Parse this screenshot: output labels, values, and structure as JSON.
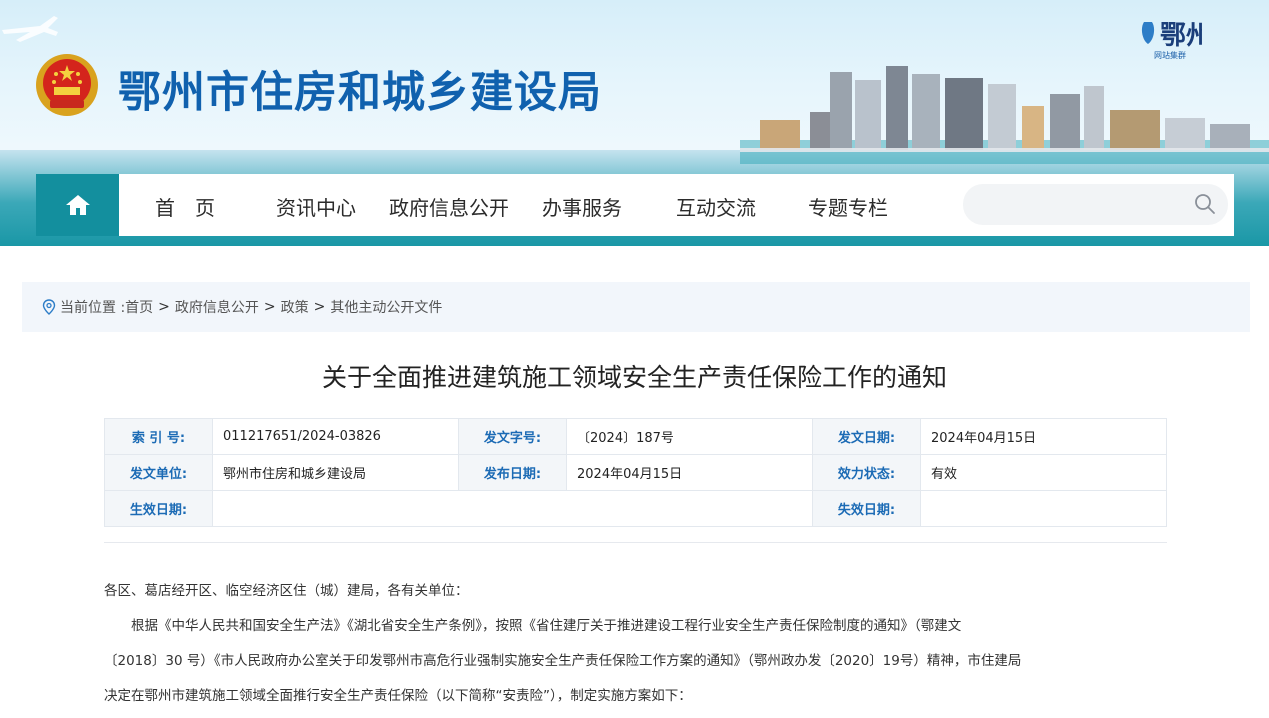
{
  "header": {
    "site_title": "鄂州市住房和城乡建设局",
    "city_logo_glyph": "鄂州",
    "city_logo_subtext": "网站集群"
  },
  "nav": {
    "home_icon": "home-icon",
    "items": [
      "首　页",
      "资讯中心",
      "政府信息公开",
      "办事服务",
      "互动交流",
      "专题专栏"
    ],
    "search_placeholder": ""
  },
  "breadcrumb": {
    "prefix": "当前位置 :",
    "items": [
      "首页",
      "政府信息公开",
      "政策",
      "其他主动公开文件"
    ],
    "separator": ">"
  },
  "article": {
    "title": "关于全面推进建筑施工领域安全生产责任保险工作的通知"
  },
  "meta": {
    "index_label": "索 引 号:",
    "index_value": "011217651/2024-03826",
    "doc_no_label": "发文字号:",
    "doc_no_value": "〔2024〕187号",
    "issue_date_label": "发文日期:",
    "issue_date_value": "2024年04月15日",
    "issuer_label": "发文单位:",
    "issuer_value": "鄂州市住房和城乡建设局",
    "publish_date_label": "发布日期:",
    "publish_date_value": "2024年04月15日",
    "status_label": "效力状态:",
    "status_value": "有效",
    "effective_label": "生效日期:",
    "effective_value": "",
    "expire_label": "失效日期:",
    "expire_value": ""
  },
  "body": {
    "salutation": "各区、葛店经开区、临空经济区住（城）建局，各有关单位：",
    "para1_line1": "根据《中华人民共和国安全生产法》《湖北省安全生产条例》，按照《省住建厅关于推进建设工程行业安全生产责任保险制度的通知》（鄂建文",
    "para1_line2": "〔2018〕30 号）《市人民政府办公室关于印发鄂州市高危行业强制实施安全生产责任保险工作方案的通知》（鄂州政办发〔2020〕19号）精神，市住建局",
    "para1_line3": "决定在鄂州市建筑施工领域全面推行安全生产责任保险（以下简称“安责险”），制定实施方案如下："
  },
  "colors": {
    "title_blue": "#1061ae",
    "nav_teal": "#138f9e",
    "label_blue": "#1c6bb5"
  }
}
